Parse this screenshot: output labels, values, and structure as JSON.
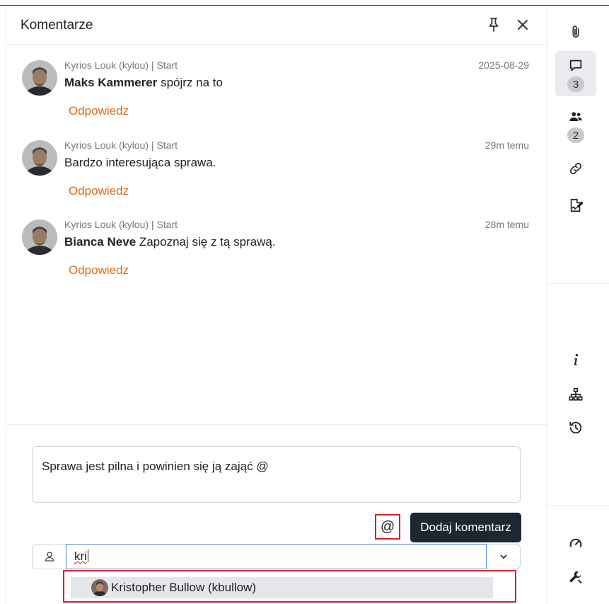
{
  "panel": {
    "title": "Komentarze",
    "pin_icon": "pin-icon",
    "close_icon": "close-icon"
  },
  "comments": [
    {
      "author_meta": "Kyrios Louk (kylou) | Start",
      "date": "2025-08-29",
      "mention": "Maks Kammerer",
      "text": " spójrz na to",
      "reply_label": "Odpowiedz"
    },
    {
      "author_meta": "Kyrios Louk (kylou) | Start",
      "date": "29m temu",
      "mention": "",
      "text": "Bardzo interesująca sprawa.",
      "reply_label": "Odpowiedz"
    },
    {
      "author_meta": "Kyrios Louk (kylou) | Start",
      "date": "28m temu",
      "mention": "Bianca Neve",
      "text": " Zapoznaj się z tą sprawą.",
      "reply_label": "Odpowiedz"
    }
  ],
  "composer": {
    "value": "Sprawa jest pilna i powinien się ją zająć @",
    "at_label": "@",
    "submit_label": "Dodaj komentarz"
  },
  "user_picker": {
    "value": "kri",
    "suggestion": "Kristopher Bullow (kbullow)"
  },
  "sidebar": {
    "comments_count": "3",
    "participants_count": "2",
    "icons": [
      "paperclip-icon",
      "comment-icon",
      "users-icon",
      "link-icon",
      "signature-icon",
      "info-icon",
      "sitemap-icon",
      "history-icon",
      "gauge-icon",
      "wrench-icon"
    ]
  },
  "colors": {
    "accent_orange": "#e06b14",
    "highlight_red": "#d32027",
    "dark_button": "#1c2732"
  }
}
